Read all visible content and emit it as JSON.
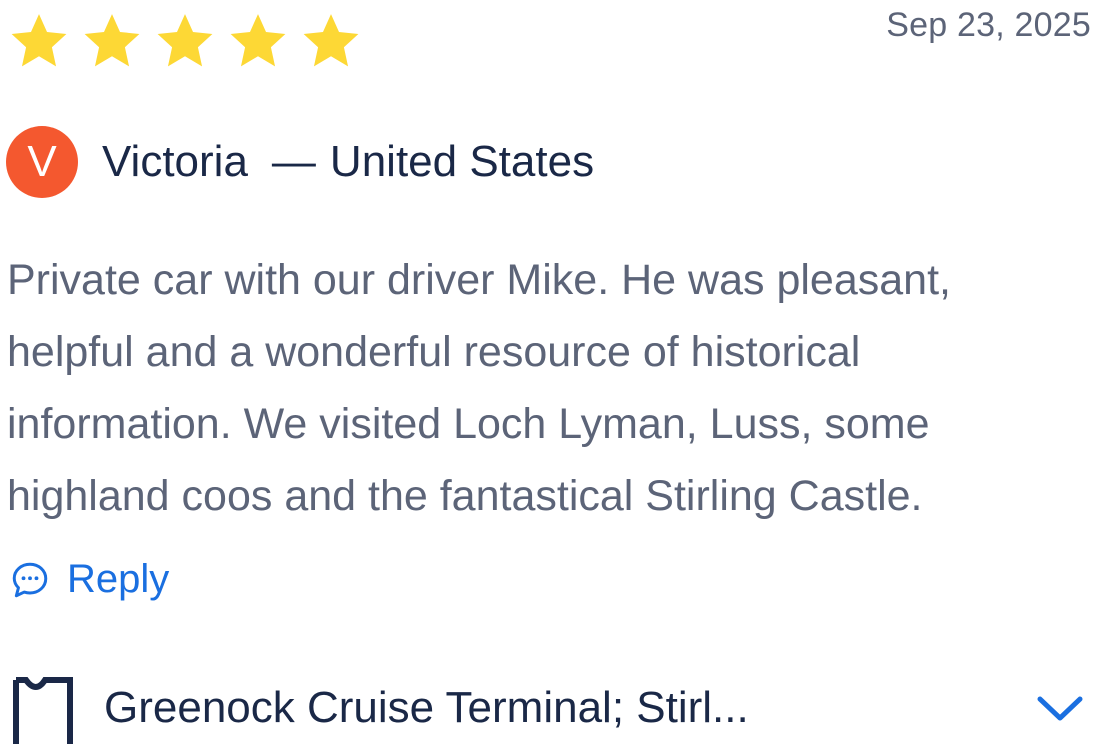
{
  "review": {
    "rating": 5,
    "max_rating": 5,
    "star_color": "#fdd835",
    "date": "Sep 23, 2025",
    "author": {
      "initial": "V",
      "name": "Victoria",
      "separator": "—",
      "country": "United States",
      "avatar_color": "#f4582f"
    },
    "text": "Private car with our driver Mike. He was pleasant, helpful and a wonderful resource of historical information. We visited Loch Lyman, Luss, some highland coos and the fantastical Stirling Castle.",
    "reply": {
      "icon": "chat-bubble-icon",
      "label": "Reply",
      "color": "#1a6fe0"
    },
    "tour": {
      "icon": "ticket-icon",
      "name": "Greenock Cruise Terminal; Stirl...",
      "expand_icon": "chevron-down-icon"
    }
  }
}
